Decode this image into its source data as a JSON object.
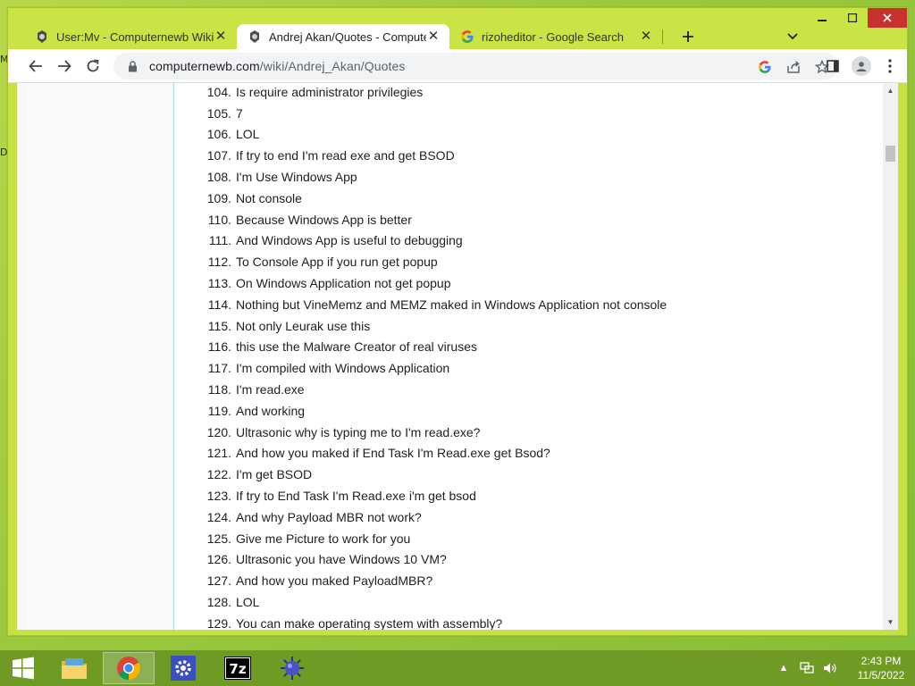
{
  "desktop": {
    "edge_text_1": "M",
    "edge_text_2": "D"
  },
  "tabs": [
    {
      "title": "User:Mv - Computernewb Wiki",
      "icon": "wiki-favicon-icon",
      "active": false
    },
    {
      "title": "Andrej Akan/Quotes - Computer",
      "icon": "wiki-favicon-icon",
      "active": true
    },
    {
      "title": "rizoheditor - Google Search",
      "icon": "google-g-icon",
      "active": false
    }
  ],
  "address_bar": {
    "domain": "computernewb.com",
    "path": "/wiki/Andrej_Akan/Quotes"
  },
  "quotes": [
    {
      "num": "104.",
      "text": "Is require administrator privilegies"
    },
    {
      "num": "105.",
      "text": "7"
    },
    {
      "num": "106.",
      "text": "LOL"
    },
    {
      "num": "107.",
      "text": "If try to end I'm read exe and get BSOD"
    },
    {
      "num": "108.",
      "text": "I'm Use Windows App"
    },
    {
      "num": "109.",
      "text": "Not console"
    },
    {
      "num": "110.",
      "text": "Because Windows App is better"
    },
    {
      "num": "111.",
      "text": "And Windows App is useful to debugging"
    },
    {
      "num": "112.",
      "text": "To Console App if you run get popup"
    },
    {
      "num": "113.",
      "text": "On Windows Application not get popup"
    },
    {
      "num": "114.",
      "text": "Nothing but VineMemz and MEMZ maked in Windows Application not console"
    },
    {
      "num": "115.",
      "text": "Not only Leurak use this"
    },
    {
      "num": "116.",
      "text": "this use the Malware Creator of real viruses"
    },
    {
      "num": "117.",
      "text": "I'm compiled with Windows Application"
    },
    {
      "num": "118.",
      "text": "I'm read.exe"
    },
    {
      "num": "119.",
      "text": "And working"
    },
    {
      "num": "120.",
      "text": "Ultrasonic why is typing me to I'm read.exe?"
    },
    {
      "num": "121.",
      "text": "And how you maked if End Task I'm Read.exe get Bsod?"
    },
    {
      "num": "122.",
      "text": "I'm get BSOD"
    },
    {
      "num": "123.",
      "text": "If try to End Task I'm Read.exe i'm get bsod"
    },
    {
      "num": "124.",
      "text": "And why Payload MBR not work?"
    },
    {
      "num": "125.",
      "text": "Give me Picture to work for you"
    },
    {
      "num": "126.",
      "text": "Ultrasonic you have Windows 10 VM?"
    },
    {
      "num": "127.",
      "text": "And how you maked PayloadMBR?"
    },
    {
      "num": "128.",
      "text": "LOL"
    },
    {
      "num": "129.",
      "text": "You can make operating system with assembly?"
    }
  ],
  "taskbar": {
    "items": [
      {
        "name": "file-explorer-icon",
        "active": false
      },
      {
        "name": "chrome-icon",
        "active": true
      },
      {
        "name": "settings-gear-icon",
        "active": false
      },
      {
        "name": "7zip-icon",
        "active": false
      },
      {
        "name": "virus-app-icon",
        "active": false
      }
    ],
    "clock_time": "2:43 PM",
    "clock_date": "11/5/2022"
  },
  "colors": {
    "desktop": "#9cc83e",
    "window_frame": "#c9e445",
    "taskbar": "#6f9a24",
    "close_button": "#c7322f"
  }
}
